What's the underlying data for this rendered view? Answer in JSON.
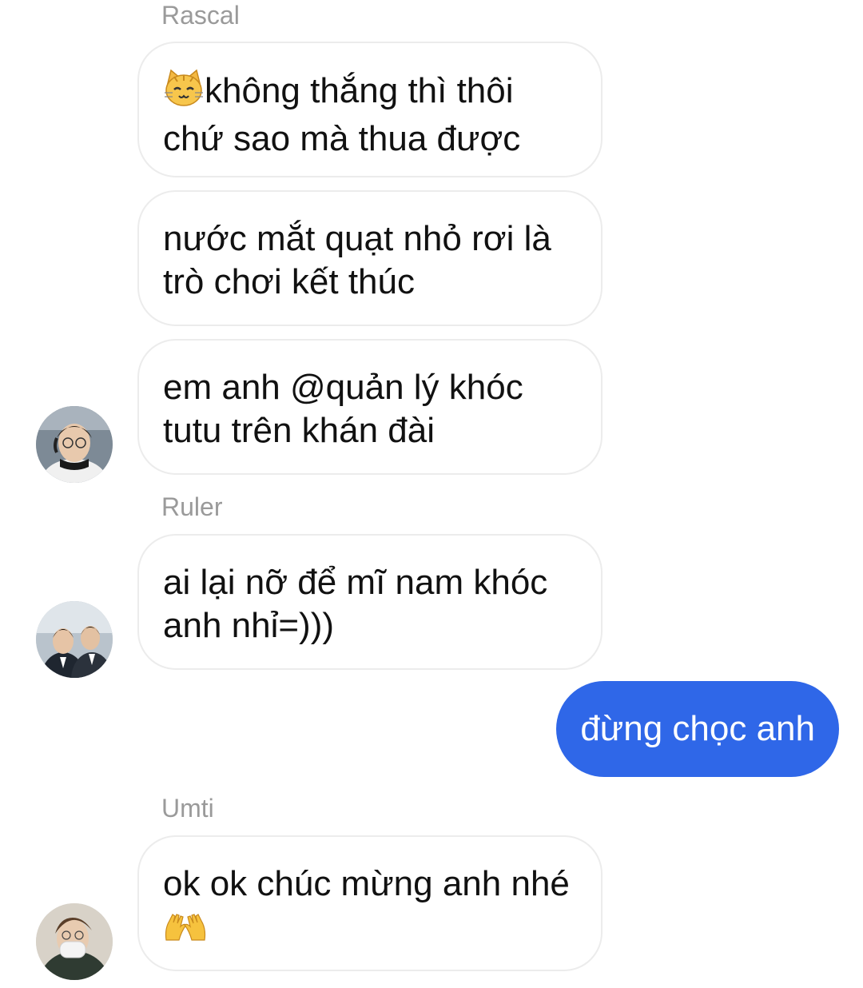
{
  "messages": [
    {
      "sender": "Rascal",
      "bubbles": [
        {
          "line1": "không thắng thì thôi",
          "line2": "chứ sao mà thua được",
          "emoji": "cat-face"
        },
        {
          "line1": "nước mắt quạt nhỏ rơi là",
          "line2": "trò chơi kết thúc"
        },
        {
          "line1": "em anh @quản lý khóc",
          "line2": "tutu trên khán đài"
        }
      ]
    },
    {
      "sender": "Ruler",
      "bubbles": [
        {
          "line1": "ai lại nỡ để mĩ nam khóc",
          "line2": "anh nhỉ=)))"
        }
      ]
    },
    {
      "outgoing": "đừng chọc anh"
    },
    {
      "sender": "Umti",
      "bubbles": [
        {
          "line1": "ok ok chúc mừng anh nhé",
          "emoji": "raised-hands"
        }
      ]
    }
  ],
  "colors": {
    "outgoing_bubble": "#2f67e8",
    "sender_name": "#9a9a9a"
  }
}
